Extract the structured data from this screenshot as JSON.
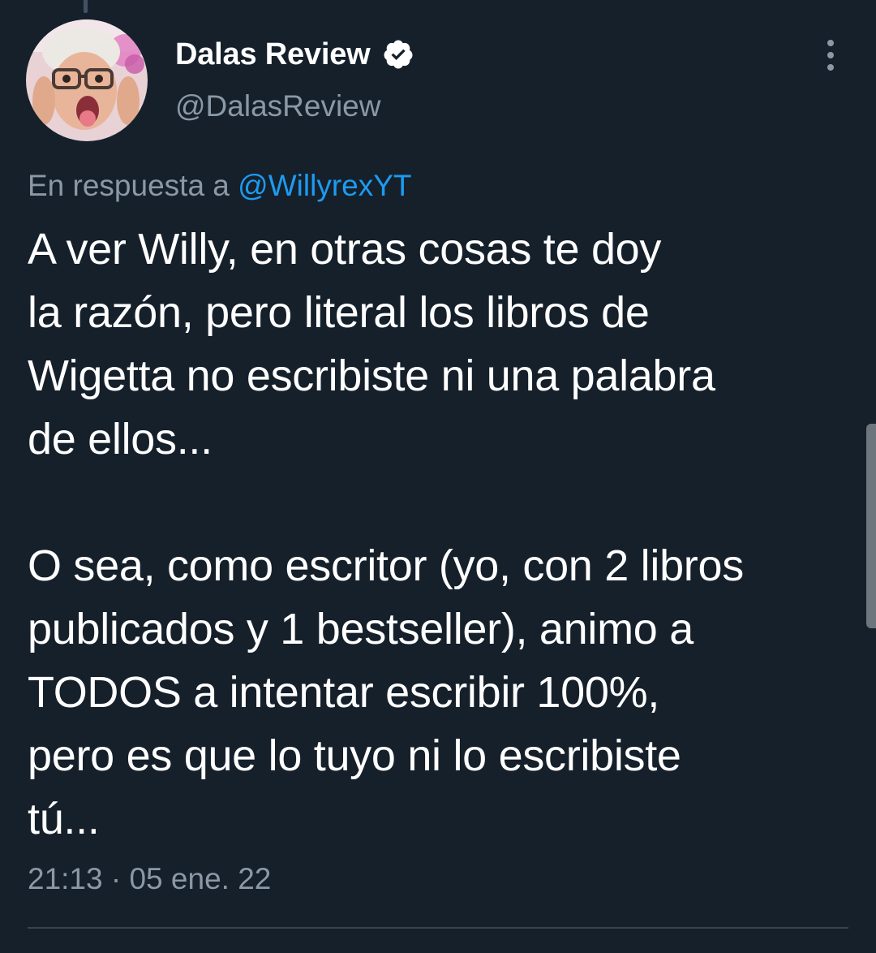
{
  "tweet": {
    "author": {
      "display_name": "Dalas Review",
      "handle": "@DalasReview",
      "verified_icon": "verified-badge-icon"
    },
    "reply_prefix": "En respuesta a ",
    "reply_to": "@WillyrexYT",
    "text": "A ver Willy, en otras cosas te doy\nla razón, pero literal los libros de\nWigetta no escribiste ni una palabra\nde ellos...\n\nO sea, como escritor (yo, con 2 libros\npublicados y 1 bestseller), animo a\nTODOS a intentar escribir 100%,\npero es que lo tuyo ni lo escribiste\ntú...",
    "time": "21:13",
    "separator": " · ",
    "date": "05 ene. 22",
    "more_icon": "more-options-icon"
  },
  "colors": {
    "background": "#15202b",
    "primary_text": "#ffffff",
    "secondary_text": "#8b98a5",
    "link": "#1d9bf0",
    "divider": "#38444d"
  }
}
